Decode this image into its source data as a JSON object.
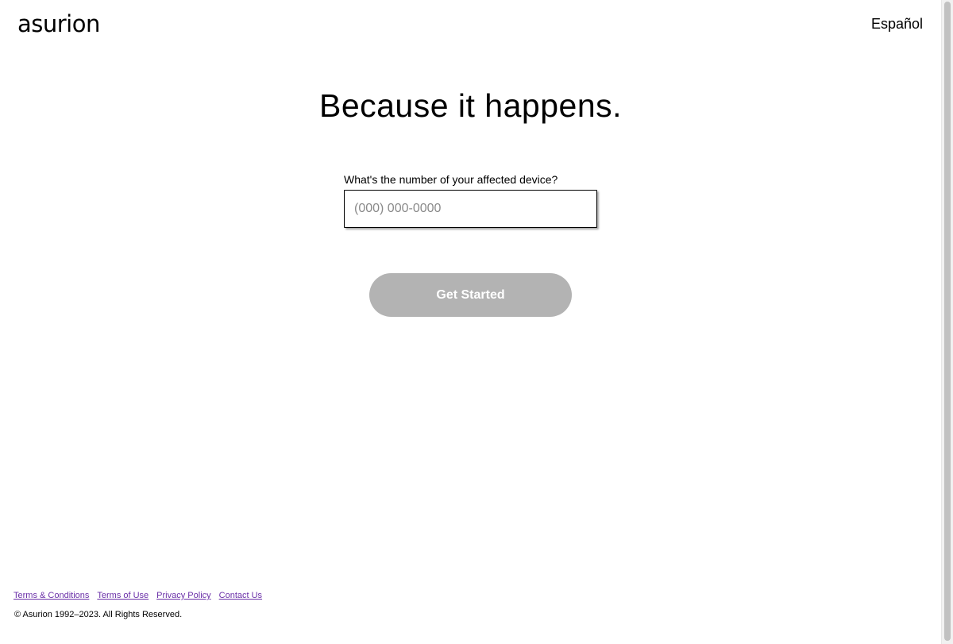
{
  "header": {
    "logo_text": "asurion",
    "language_link": "Español"
  },
  "main": {
    "headline": "Because it happens.",
    "phone_label": "What's the number of your affected device?",
    "phone_placeholder": "(000) 000-0000",
    "phone_value": "",
    "submit_label": "Get Started"
  },
  "footer": {
    "links": [
      {
        "label": "Terms & Conditions"
      },
      {
        "label": "Terms of Use"
      },
      {
        "label": "Privacy Policy"
      },
      {
        "label": "Contact Us"
      }
    ],
    "copyright": "© Asurion 1992–2023. All Rights Reserved."
  },
  "colors": {
    "button_disabled_bg": "#b3b3b3",
    "link": "#6a2fa8",
    "text": "#000000",
    "background": "#ffffff"
  }
}
